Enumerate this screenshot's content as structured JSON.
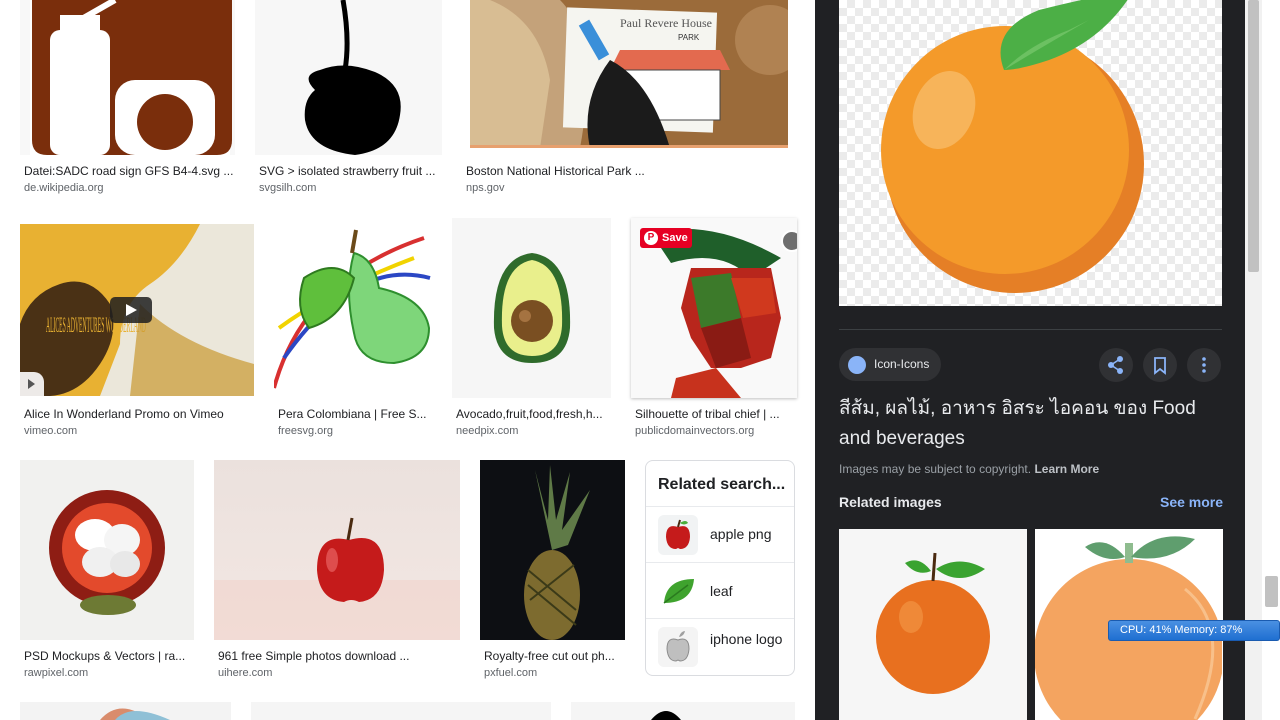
{
  "results": {
    "row1": [
      {
        "caption": "Datei:SADC road sign GFS B4-4.svg ...",
        "domain": "de.wikipedia.org"
      },
      {
        "caption": "SVG > isolated strawberry fruit ...",
        "domain": "svgsilh.com"
      },
      {
        "caption": "Boston National Historical Park ...",
        "domain": "nps.gov"
      }
    ],
    "row2": [
      {
        "caption": "Alice In Wonderland Promo on Vimeo",
        "domain": "vimeo.com"
      },
      {
        "caption": "Pera Colombiana | Free S...",
        "domain": "freesvg.org"
      },
      {
        "caption": "Avocado,fruit,food,fresh,h...",
        "domain": "needpix.com"
      },
      {
        "caption": "Silhouette of tribal chief | ...",
        "domain": "publicdomainvectors.org"
      }
    ],
    "row3": [
      {
        "caption": "PSD Mockups & Vectors | ra...",
        "domain": "rawpixel.com"
      },
      {
        "caption": "961 free Simple photos download ...",
        "domain": "uihere.com"
      },
      {
        "caption": "Royalty-free cut out ph...",
        "domain": "pxfuel.com"
      }
    ],
    "save_label": "Save",
    "poster_text": {
      "thumb1": "Paul Revere House",
      "thumb1_sub": "PARK",
      "alice": "ALICES ADVENTURES WONDERLAND"
    }
  },
  "related_searches": {
    "title": "Related search...",
    "items": [
      {
        "label": "apple png"
      },
      {
        "label": "leaf"
      },
      {
        "label": "iphone logo"
      }
    ]
  },
  "panel": {
    "source": "Icon-Icons",
    "title": "สีส้ม, ผลไม้, อาหาร อิสระ ไอคอน ของ Food and beverages",
    "copyright": "Images may be subject to copyright.",
    "learn_more": "Learn More",
    "related_images": "Related images",
    "see_more": "See more"
  },
  "system": {
    "cpu_memory": "CPU: 41%   Memory: 87%"
  },
  "colors": {
    "panel_bg": "#202124",
    "accent_blue": "#8ab4f8",
    "orange": "#f49a2a",
    "pinterest_red": "#e60023"
  }
}
